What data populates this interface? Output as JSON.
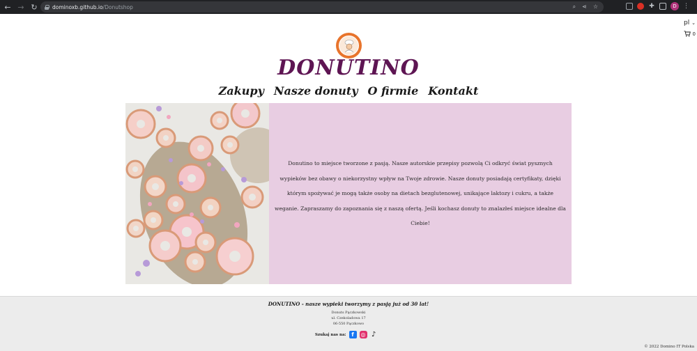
{
  "browser": {
    "url_host": "dominoxb.github.io",
    "url_path": "/Donutshop",
    "profile_initial": "D"
  },
  "header": {
    "language": "pl",
    "cart_count": "0",
    "brand": "DONUTINO"
  },
  "menu": [
    {
      "label": "Zakupy"
    },
    {
      "label": "Nasze donuty"
    },
    {
      "label": "O firmie"
    },
    {
      "label": "Kontakt"
    }
  ],
  "hero": {
    "text": "Donutino to miejsce tworzone z pasją. Nasze autorskie przepisy pozwolą Ci odkryć świat pysznych wypieków bez obawy o niekorzystny wpływ na Twoje zdrowie. Nasze donuty posiadają certyfikaty, dzięki którym spożywać je mogą także osoby na dietach bezglutenowej, unikające laktozy i cukru, a także weganie. Zapraszamy do zapoznania się z naszą ofertą. Jeśli kochasz donuty to znalazłeś miejsce idealne dla Ciebie!"
  },
  "footer": {
    "slogan_brand": "DONUTINO",
    "slogan_rest": " - nasze wypieki tworzymy z pasją już od 30 lat!",
    "address_name": "Donuts Pączkowski",
    "address_street": "ul. Czekoladowa 17",
    "address_city": "06-550 Pączkowo",
    "social_label": "Szukaj nas na:",
    "copyright": "© 2022 Domino IT Polska"
  },
  "colors": {
    "brand": "#5e1553",
    "hero_bg": "#e8cde2",
    "footer_bg": "#ececec",
    "logo_orange": "#e8742c"
  },
  "icons": [
    "back-icon",
    "forward-icon",
    "reload-icon",
    "lock-icon",
    "cart-icon",
    "facebook-icon",
    "instagram-icon",
    "tiktok-icon"
  ]
}
